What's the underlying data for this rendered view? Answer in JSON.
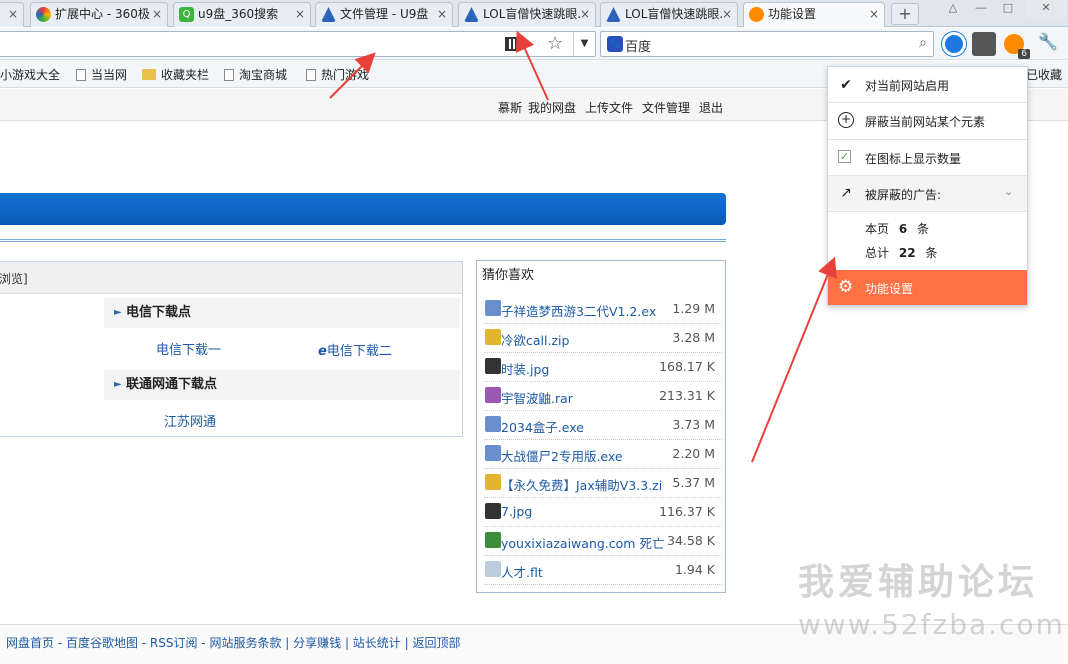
{
  "tabs": [
    {
      "title": "扩展中心 - 360极",
      "color": "#e8403a"
    },
    {
      "title": "u9盘_360搜索",
      "color": "#3bb53b"
    },
    {
      "title": "文件管理 - U9盘",
      "color": "#2b63b8"
    },
    {
      "title": "LOL盲僧快速跳眼.",
      "color": "#2b63b8"
    },
    {
      "title": "LOL盲僧快速跳眼.",
      "color": "#2b63b8"
    },
    {
      "title": "功能设置",
      "color": "#ff8a00"
    }
  ],
  "first_tab_close": "×",
  "tab_close": "×",
  "new_tab": "+",
  "search_engine": "百度",
  "bookmarks": [
    "小游戏大全",
    "当当网",
    "收藏夹栏",
    "淘宝商城",
    "热门游戏",
    "已收藏"
  ],
  "site_nav": [
    "慕斯",
    "我的网盘",
    "上传文件",
    "文件管理",
    "退出"
  ],
  "left_header_text": "浏览]",
  "telecom_title": "电信下载点",
  "telecom_link1": "电信下载一",
  "telecom_link2": "电信下载二",
  "unicom_title": "联通网通下载点",
  "unicom_link1": "江苏网通",
  "guess_title": "猜你喜欢",
  "files": [
    {
      "name": "子祥造梦西游3二代V1.2.ex",
      "size": "1.29 M",
      "icon": "#6a8fd0"
    },
    {
      "name": "冷欲call.zip",
      "size": "3.28 M",
      "icon": "#e3b432"
    },
    {
      "name": "时装.jpg",
      "size": "168.17 K",
      "icon": "#333"
    },
    {
      "name": "宇智波鼬.rar",
      "size": "213.31 K",
      "icon": "#9b59b6"
    },
    {
      "name": "2034盒子.exe",
      "size": "3.73 M",
      "icon": "#6a8fd0"
    },
    {
      "name": "大战僵尸2专用版.exe",
      "size": "2.20 M",
      "icon": "#6a8fd0"
    },
    {
      "name": "【永久免费】Jax辅助V3.3.zi",
      "size": "5.37 M",
      "icon": "#e3b432"
    },
    {
      "name": "7.jpg",
      "size": "116.37 K",
      "icon": "#333"
    },
    {
      "name": "youxixiazaiwang.com 死亡",
      "size": "34.58 K",
      "icon": "#3b8e3b"
    },
    {
      "name": "人才.flt",
      "size": "1.94 K",
      "icon": "#bcd"
    }
  ],
  "footer": "网盘首页 - 百度谷歌地图 - RSS订阅 - 网站服务条款 | 分享赚钱 | 站长统计 | 返回顶部",
  "dropdown": {
    "enable": "对当前网站启用",
    "block_element": "屏蔽当前网站某个元素",
    "show_count": "在图标上显示数量",
    "blocked_ads": "被屏蔽的广告:",
    "this_page_label": "本页",
    "this_page_count": "6",
    "this_page_unit": "条",
    "total_label": "总计",
    "total_count": "22",
    "total_unit": "条",
    "settings": "功能设置"
  },
  "badge_count": "6",
  "watermark": "我爱辅助论坛",
  "watermark_url": "www.52fzba.com",
  "accent": "#ff7043",
  "blue": "#0a5ab5"
}
